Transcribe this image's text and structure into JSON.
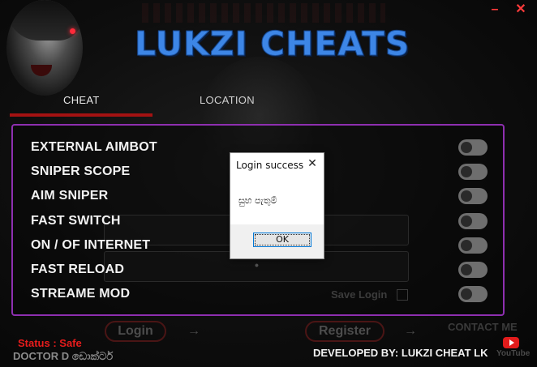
{
  "header": {
    "brand": "LUKZI CHEATS",
    "minimize_label": "–",
    "close_label": "✕"
  },
  "tabs": [
    {
      "label": "CHEAT",
      "active": true
    },
    {
      "label": "LOCATION",
      "active": false
    }
  ],
  "cheats": [
    {
      "label": "EXTERNAL AIMBOT",
      "enabled": false
    },
    {
      "label": "SNIPER SCOPE",
      "enabled": false
    },
    {
      "label": "AIM SNIPER",
      "enabled": false
    },
    {
      "label": "FAST SWITCH",
      "enabled": false
    },
    {
      "label": "ON / OF INTERNET",
      "enabled": false
    },
    {
      "label": "FAST RELOAD",
      "enabled": false
    },
    {
      "label": "STREAME MOD",
      "enabled": false
    }
  ],
  "login_backdrop": {
    "save_login": "Save Login",
    "login_button": "Login",
    "register_button": "Register",
    "password_mask": "•"
  },
  "footer": {
    "status": "Status : Safe",
    "doctor": "DOCTOR D ඩොක්ටර්",
    "developed_by": "DEVELOPED BY: LUKZI CHEAT LK",
    "contact": "CONTACT ME",
    "youtube_label": "YouTube"
  },
  "dialog": {
    "title": "Login success",
    "message": "සුභ පැතුම්",
    "ok_label": "OK",
    "close_label": "✕"
  },
  "colors": {
    "brand_blue": "#3d86e6",
    "panel_border": "#8e2fb0",
    "tab_underline": "#a41212",
    "status_red": "#e81c1c",
    "toggle_off": "#6e6e6e"
  }
}
